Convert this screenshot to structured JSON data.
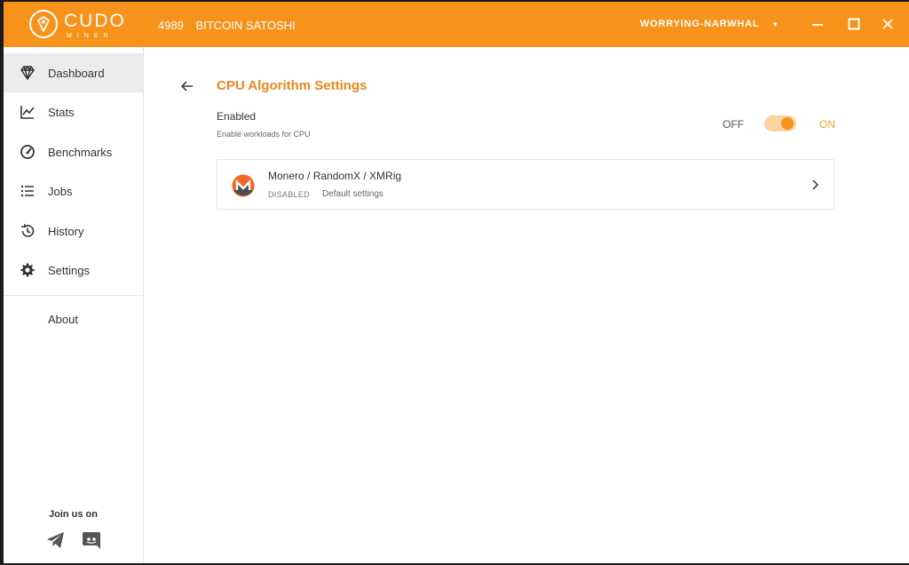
{
  "titlebar": {
    "logo_word": "CUDO",
    "logo_sub": "MINER",
    "balance_amount": "4989",
    "balance_unit": "BITCOIN SATOSHI",
    "username": "WORRYING-NARWHAL",
    "accent_color": "#f7931a"
  },
  "sidebar": {
    "items": [
      {
        "label": "Dashboard",
        "icon": "diamond-icon"
      },
      {
        "label": "Stats",
        "icon": "line-chart-icon"
      },
      {
        "label": "Benchmarks",
        "icon": "speedometer-icon"
      },
      {
        "label": "Jobs",
        "icon": "list-icon"
      },
      {
        "label": "History",
        "icon": "history-icon"
      },
      {
        "label": "Settings",
        "icon": "gear-icon"
      }
    ],
    "about_label": "About",
    "join_label": "Join us on",
    "social": [
      "telegram-icon",
      "discord-icon"
    ]
  },
  "main": {
    "title": "CPU Algorithm Settings",
    "enabled_label": "Enabled",
    "enabled_sub": "Enable workloads for CPU",
    "toggle_off_label": "OFF",
    "toggle_on_label": "ON",
    "toggle_on": true,
    "algorithm": {
      "name": "Monero / RandomX / XMRig",
      "status": "DISABLED",
      "settings": "Default settings",
      "icon": "monero-icon"
    }
  }
}
